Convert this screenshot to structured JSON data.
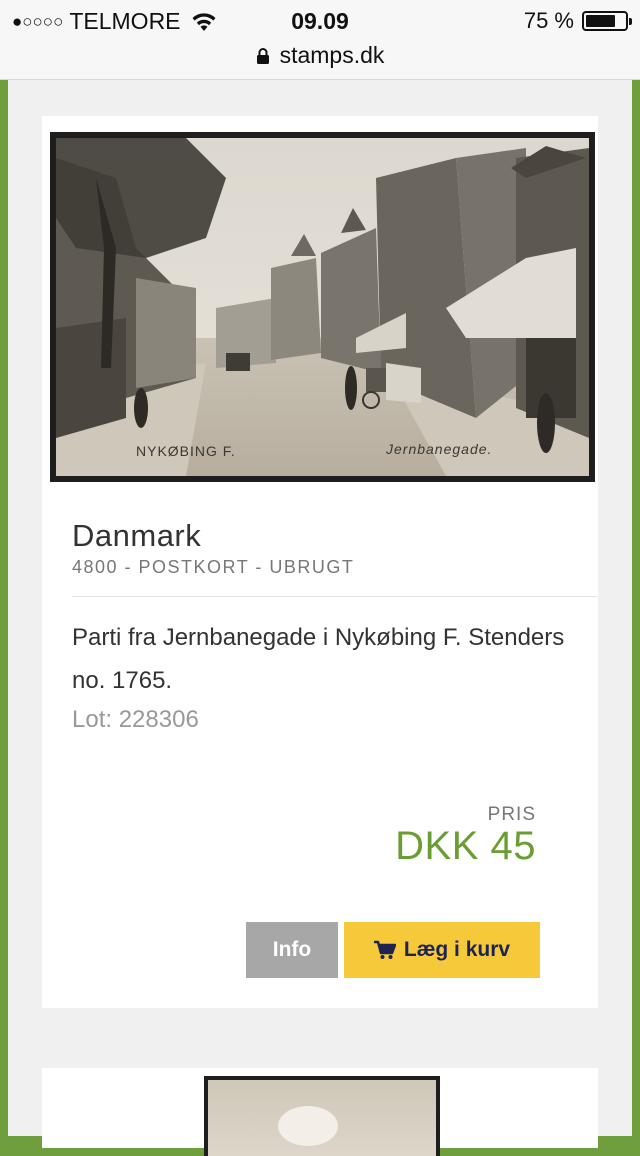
{
  "status_bar": {
    "signal": "●○○○○",
    "carrier": "TELMORE",
    "time": "09.09",
    "battery": "75 %",
    "battery_level": 0.75
  },
  "url_bar": {
    "domain": "stamps.dk"
  },
  "listing": {
    "image": {
      "caption_left": "NYKØBING F.",
      "caption_right": "Jernbanegade."
    },
    "title": "Danmark",
    "subtitle": "4800 - POSTKORT - UBRUGT",
    "description": "Parti fra Jernbanegade i Nykøbing F. Stenders no. 1765.",
    "lot": "Lot: 228306",
    "price_label": "PRIS",
    "price": "DKK 45",
    "buttons": {
      "info": "Info",
      "add_to_cart": "Læg i kurv"
    },
    "colors": {
      "price": "#6a9e33",
      "cart_button": "#f6c93a",
      "info_button": "#a7a7a7",
      "frame": "#6f9e3c"
    }
  }
}
